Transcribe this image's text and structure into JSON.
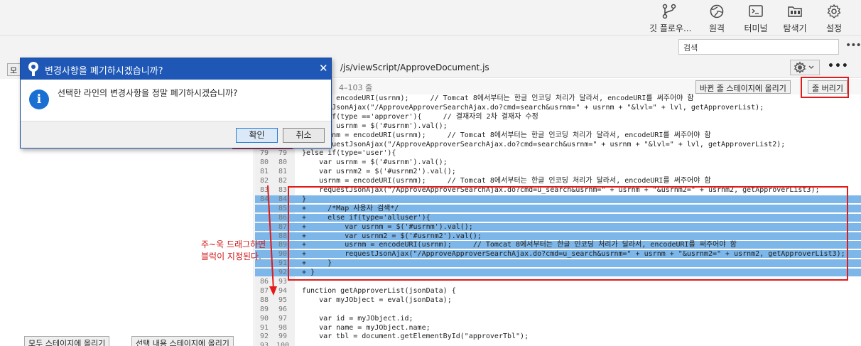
{
  "toolbar": {
    "items": [
      {
        "label": "깃 플로우...",
        "icon": "git-flow-icon"
      },
      {
        "label": "원격",
        "icon": "globe-icon"
      },
      {
        "label": "터미널",
        "icon": "terminal-icon"
      },
      {
        "label": "탐색기",
        "icon": "explorer-icon"
      },
      {
        "label": "설정",
        "icon": "gear-icon"
      }
    ]
  },
  "search": {
    "placeholder": "검색"
  },
  "left": {
    "top_button": "모",
    "stage_all": "모두 스테이지에 올리기",
    "stage_selected": "선택 내용 스테이지에 올리기"
  },
  "file": {
    "path": "/js/viewScript/ApproveDocument.js"
  },
  "hunk": {
    "label": "4–103 줄",
    "stage_button": "바뀐 줄 스테이지에 올리기",
    "discard_button": "줄 버리기"
  },
  "dialog": {
    "title": "변경사항을 폐기하시겠습니까?",
    "message": "선택한 라인의 변경사항을 정말 폐기하시겠습니까?",
    "ok": "확인",
    "cancel": "취소"
  },
  "annotation": {
    "line1": "주~욱 드래그하면",
    "line2": "블럭이 지정된다."
  },
  "code": [
    {
      "o": "",
      "n": "",
      "t": "usrnm = encodeURI(usrnm);     // Tomcat 8에서부터는 한글 인코딩 처리가 달라서, encodeURI를 써주어야 함",
      "sel": false
    },
    {
      "o": "",
      "n": "",
      "t": "requestJsonAjax(\"/ApproveApproverSearchAjax.do?cmd=search&usrnm=\" + usrnm + \"&lvl=\" + lvl, getApproverList);",
      "sel": false
    },
    {
      "o": "",
      "n": "",
      "t": "}else if(type =='approver'){     // 결재자의 2차 결재자 수정",
      "sel": false
    },
    {
      "o": "",
      "n": "",
      "t": "    var usrnm = $('#usrnm').val();",
      "sel": false
    },
    {
      "o": "",
      "n": "",
      "t": "    usrnm = encodeURI(usrnm);     // Tomcat 8에서부터는 한글 인코딩 처리가 달라서, encodeURI를 써주어야 함",
      "sel": false
    },
    {
      "o": "",
      "n": "",
      "t": "    requestJsonAjax(\"/ApproveApproverSearchAjax.do?cmd=search&usrnm=\" + usrnm + \"&lvl=\" + lvl, getApproverList2);",
      "sel": false
    },
    {
      "o": "79",
      "n": "79",
      "t": "}else if(type='user'){",
      "sel": false
    },
    {
      "o": "80",
      "n": "80",
      "t": "    var usrnm = $('#usrnm').val();",
      "sel": false
    },
    {
      "o": "81",
      "n": "81",
      "t": "    var usrnm2 = $('#usrnm2').val();",
      "sel": false
    },
    {
      "o": "82",
      "n": "82",
      "t": "    usrnm = encodeURI(usrnm);     // Tomcat 8에서부터는 한글 인코딩 처리가 달라서, encodeURI를 써주어야 함",
      "sel": false
    },
    {
      "o": "83",
      "n": "83",
      "t": "    requestJsonAjax(\"/ApproveApproverSearchAjax.do?cmd=u_search&usrnm=\" + usrnm + \"&usrnm2=\" + usrnm2, getApproverList3);",
      "sel": false
    },
    {
      "o": "84",
      "n": "84",
      "t": "}",
      "sel": true
    },
    {
      "o": "",
      "n": "85",
      "t": "+     /*Map 사용자 검색*/",
      "sel": true
    },
    {
      "o": "",
      "n": "86",
      "t": "+     else if(type='alluser'){",
      "sel": true
    },
    {
      "o": "",
      "n": "87",
      "t": "+         var usrnm = $('#usrnm').val();",
      "sel": true
    },
    {
      "o": "",
      "n": "88",
      "t": "+         var usrnm2 = $('#usrnm2').val();",
      "sel": true
    },
    {
      "o": "",
      "n": "89",
      "t": "+         usrnm = encodeURI(usrnm);     // Tomcat 8에서부터는 한글 인코딩 처리가 달라서, encodeURI를 써주어야 함",
      "sel": true
    },
    {
      "o": "",
      "n": "90",
      "t": "+         requestJsonAjax(\"/ApproveApproverSearchAjax.do?cmd=u_search&usrnm=\" + usrnm + \"&usrnm2=\" + usrnm2, getApproverList3);",
      "sel": true
    },
    {
      "o": "",
      "n": "91",
      "t": "+     }",
      "sel": true
    },
    {
      "o": "",
      "n": "92",
      "t": "+ }",
      "sel": true
    },
    {
      "o": "86",
      "n": "93",
      "t": "",
      "sel": false
    },
    {
      "o": "87",
      "n": "94",
      "t": "function getApproverList(jsonData) {",
      "sel": false
    },
    {
      "o": "88",
      "n": "95",
      "t": "    var myJObject = eval(jsonData);",
      "sel": false
    },
    {
      "o": "89",
      "n": "96",
      "t": "",
      "sel": false
    },
    {
      "o": "90",
      "n": "97",
      "t": "    var id = myJObject.id;",
      "sel": false
    },
    {
      "o": "91",
      "n": "98",
      "t": "    var name = myJObject.name;",
      "sel": false
    },
    {
      "o": "92",
      "n": "99",
      "t": "    var tbl = document.getElementById(\"approverTbl\");",
      "sel": false
    },
    {
      "o": "93",
      "n": "100",
      "t": "",
      "sel": false
    }
  ]
}
